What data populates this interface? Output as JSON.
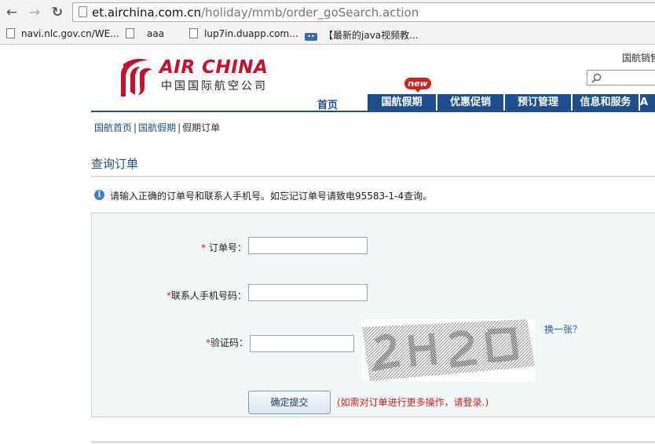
{
  "browser": {
    "back_icon": "back-arrow-icon",
    "forward_icon": "forward-arrow-icon",
    "reload_icon": "reload-icon",
    "url_host": "et.airchina.com.cn",
    "url_path": "/holiday/mmb/order_goSearch.action",
    "bookmarks": [
      {
        "label": "navi.nlc.gov.cn/WE...",
        "icon": "page-icon"
      },
      {
        "label": "aaa",
        "icon": "page-icon"
      },
      {
        "label": "lup7in.duapp.com...",
        "icon": "page-icon"
      },
      {
        "label": "【最新的java视频教...",
        "icon": "site-logo-icon"
      }
    ]
  },
  "site": {
    "logo_en": "AIR CHINA",
    "logo_cn": "中国国际航空公司",
    "top_link": "国航销售",
    "search_icon": "magnifier-icon",
    "nav_home": "首页",
    "new_badge": "new",
    "nav_items": [
      "国航假期",
      "优惠促销",
      "预订管理",
      "信息和服务",
      "A"
    ]
  },
  "breadcrumb": [
    "国航首页",
    "国航假期",
    "假期订单"
  ],
  "page_title": "查询订单",
  "info_text": "请输入正确的订单号和联系人手机号。如忘记订单号请致电95583-1-4查询。",
  "form": {
    "required_mark": "*",
    "order_label": " 订单号：",
    "phone_label": "联系人手机号码：",
    "captcha_label": "验证码：",
    "order_value": "",
    "phone_value": "",
    "captcha_value": "",
    "refresh_label": "换一张？",
    "submit_label": "确定提交",
    "login_note": "(如需对订单进行更多操作，请登录.)"
  },
  "colors": {
    "brand_red": "#c8102e",
    "nav_blue": "#1e4e8e",
    "link_blue": "#1f4e8c",
    "panel_bg": "#f1f7f7"
  }
}
